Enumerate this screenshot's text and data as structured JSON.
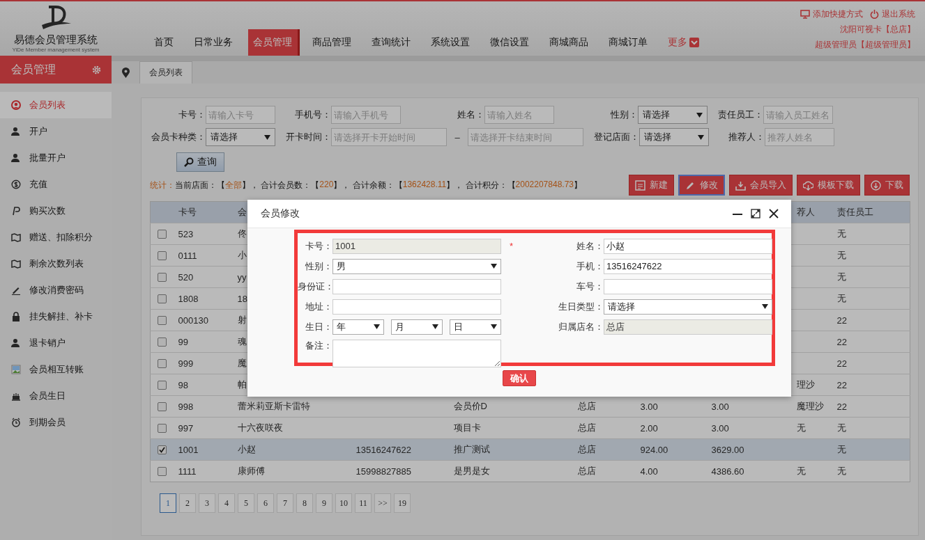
{
  "app": {
    "title": "易德会员管理系统",
    "subtitle": "YiDe Member management system"
  },
  "nav": [
    {
      "label": "首页",
      "selected": false,
      "kind": "item"
    },
    {
      "label": "日常业务",
      "selected": false,
      "kind": "item"
    },
    {
      "label": "会员管理",
      "selected": true,
      "kind": "item"
    },
    {
      "label": "商品管理",
      "selected": false,
      "kind": "item"
    },
    {
      "label": "查询统计",
      "selected": false,
      "kind": "item"
    },
    {
      "label": "系统设置",
      "selected": false,
      "kind": "item"
    },
    {
      "label": "微信设置",
      "selected": false,
      "kind": "item"
    },
    {
      "label": "商城商品",
      "selected": false,
      "kind": "item"
    },
    {
      "label": "商城订单",
      "selected": false,
      "kind": "item"
    },
    {
      "label": "更多",
      "selected": false,
      "kind": "more"
    }
  ],
  "user_links": [
    "添加快捷方式",
    "退出系统"
  ],
  "store": "沈阳可视卡【总店】",
  "role": "超级管理员【超级管理员】",
  "sidebar": {
    "title": "会员管理",
    "items": [
      {
        "label": "会员列表",
        "selected": true
      },
      {
        "label": "开户",
        "selected": false
      },
      {
        "label": "批量开户",
        "selected": false
      },
      {
        "label": "充值",
        "selected": false
      },
      {
        "label": "购买次数",
        "selected": false
      },
      {
        "label": "赠送、扣除积分",
        "selected": false
      },
      {
        "label": "剩余次数列表",
        "selected": false
      },
      {
        "label": "修改消费密码",
        "selected": false
      },
      {
        "label": "挂失解挂、补卡",
        "selected": false
      },
      {
        "label": "退卡销户",
        "selected": false
      },
      {
        "label": "会员相互转账",
        "selected": false
      },
      {
        "label": "会员生日",
        "selected": false
      },
      {
        "label": "到期会员",
        "selected": false
      }
    ]
  },
  "tabs": [
    {
      "label": "会员列表",
      "selected": true
    }
  ],
  "filters": [
    [
      {
        "label": "卡号：",
        "kind": "input",
        "placeholder": "请输入卡号"
      },
      {
        "label": "手机号：",
        "kind": "input",
        "placeholder": "请输入手机号"
      },
      {
        "label": "姓名：",
        "kind": "input",
        "placeholder": "请输入姓名"
      },
      {
        "label": "性别：",
        "kind": "select",
        "value": "请选择"
      },
      {
        "label": "责任员工：",
        "kind": "input",
        "placeholder": "请输入员工姓名"
      }
    ],
    [
      {
        "label": "会员卡种类：",
        "kind": "select",
        "value": "请选择"
      },
      {
        "label": "开卡时间：",
        "kind": "range",
        "placeholder": "请选择开卡开始时间",
        "separator": "–",
        "placeholder_end": "请选择开卡结束时间"
      },
      {
        "label": "登记店面：",
        "kind": "select",
        "value": "请选择"
      },
      {
        "label": "推荐人：",
        "kind": "input",
        "placeholder": "推荐人姓名"
      }
    ]
  ],
  "search_button": "查询",
  "stats": {
    "title": "统计：",
    "items": [
      {
        "label": "当前店面：【",
        "value": "全部"
      },
      {
        "label": "】， 合计会员数：【",
        "value": "220"
      },
      {
        "label": "】， 合计余额：【",
        "value": "1362428.11"
      },
      {
        "label": "】， 合计积分：【",
        "value": "2002207848.73"
      }
    ],
    "tail": "】"
  },
  "actions": [
    {
      "label": "新建",
      "selected": false
    },
    {
      "label": "修改",
      "selected": true
    },
    {
      "label": "会员导入",
      "selected": false
    },
    {
      "label": "模板下载",
      "selected": false
    },
    {
      "label": "下载",
      "selected": false
    }
  ],
  "table": {
    "columns": [
      "卡号",
      "会",
      null,
      null,
      null,
      null,
      null,
      "荐人",
      "责任员工"
    ],
    "rows": [
      {
        "checked": false,
        "selected": false,
        "cells": [
          "523",
          "佟",
          null,
          null,
          null,
          null,
          null,
          null,
          "无"
        ]
      },
      {
        "checked": false,
        "selected": false,
        "cells": [
          "0111",
          "小",
          null,
          null,
          null,
          null,
          null,
          null,
          "无"
        ]
      },
      {
        "checked": false,
        "selected": false,
        "cells": [
          "520",
          "yy",
          null,
          null,
          null,
          null,
          null,
          null,
          "无"
        ]
      },
      {
        "checked": false,
        "selected": false,
        "cells": [
          "1808",
          "18",
          null,
          null,
          null,
          null,
          null,
          null,
          "无"
        ]
      },
      {
        "checked": false,
        "selected": false,
        "cells": [
          "000130",
          "射",
          null,
          null,
          null,
          null,
          null,
          null,
          "22"
        ]
      },
      {
        "checked": false,
        "selected": false,
        "cells": [
          "99",
          "魂",
          null,
          null,
          null,
          null,
          null,
          null,
          "22"
        ]
      },
      {
        "checked": false,
        "selected": false,
        "cells": [
          "999",
          "魔",
          null,
          null,
          null,
          null,
          null,
          null,
          "22"
        ]
      },
      {
        "checked": false,
        "selected": false,
        "cells": [
          "98",
          "帕",
          null,
          null,
          null,
          null,
          null,
          "理沙",
          "22"
        ]
      },
      {
        "checked": false,
        "selected": false,
        "cells": [
          "998",
          "蕾米莉亚斯卡雷特",
          null,
          "会员价D",
          "总店",
          "3.00",
          "3.00",
          "魔理沙",
          "22"
        ]
      },
      {
        "checked": false,
        "selected": false,
        "cells": [
          "997",
          "十六夜咲夜",
          null,
          "项目卡",
          "总店",
          "2.00",
          "3.00",
          "无",
          "无"
        ]
      },
      {
        "checked": true,
        "selected": true,
        "cells": [
          "1001",
          "小赵",
          "13516247622",
          "推广测试",
          "总店",
          "924.00",
          "3629.00",
          null,
          "无"
        ]
      },
      {
        "checked": false,
        "selected": false,
        "cells": [
          "1111",
          "康师傅",
          "15998827885",
          "是男是女",
          "总店",
          "4.00",
          "4386.60",
          "无",
          "无"
        ]
      }
    ]
  },
  "pagination": [
    {
      "label": "1",
      "selected": true
    },
    {
      "label": "2",
      "selected": false
    },
    {
      "label": "3",
      "selected": false
    },
    {
      "label": "4",
      "selected": false
    },
    {
      "label": "5",
      "selected": false
    },
    {
      "label": "6",
      "selected": false
    },
    {
      "label": "7",
      "selected": false
    },
    {
      "label": "8",
      "selected": false
    },
    {
      "label": "9",
      "selected": false
    },
    {
      "label": "10",
      "selected": false
    },
    {
      "label": "11",
      "selected": false
    },
    {
      "label": ">>",
      "selected": false
    },
    {
      "label": "19",
      "selected": false
    }
  ],
  "dialog": {
    "title": "会员修改",
    "rows": [
      [
        {
          "label": "卡号：",
          "kind": "input",
          "value": "1001",
          "disabled": true,
          "marker": "*"
        },
        {
          "label": "姓名：",
          "kind": "input",
          "value": "小赵",
          "disabled": false
        }
      ],
      [
        {
          "label": "性别：",
          "kind": "select",
          "value": "男"
        },
        {
          "label": "手机：",
          "kind": "input",
          "value": "13516247622",
          "disabled": false
        }
      ],
      [
        {
          "label": "身份证：",
          "kind": "input",
          "disabled": false
        },
        {
          "label": "车号：",
          "kind": "input",
          "disabled": false
        }
      ],
      [
        {
          "label": "地址：",
          "kind": "input",
          "disabled": false
        },
        {
          "label": "生日类型：",
          "kind": "select",
          "value": "请选择"
        }
      ],
      [
        {
          "label": "生日：",
          "kind": "date_parts",
          "parts": [
            "年",
            "月",
            "日"
          ]
        },
        {
          "label": "归属店名：",
          "kind": "input",
          "value": "总店",
          "disabled": true
        }
      ],
      [
        {
          "label": "备注：",
          "kind": "textarea"
        }
      ]
    ],
    "confirm": "确认"
  }
}
